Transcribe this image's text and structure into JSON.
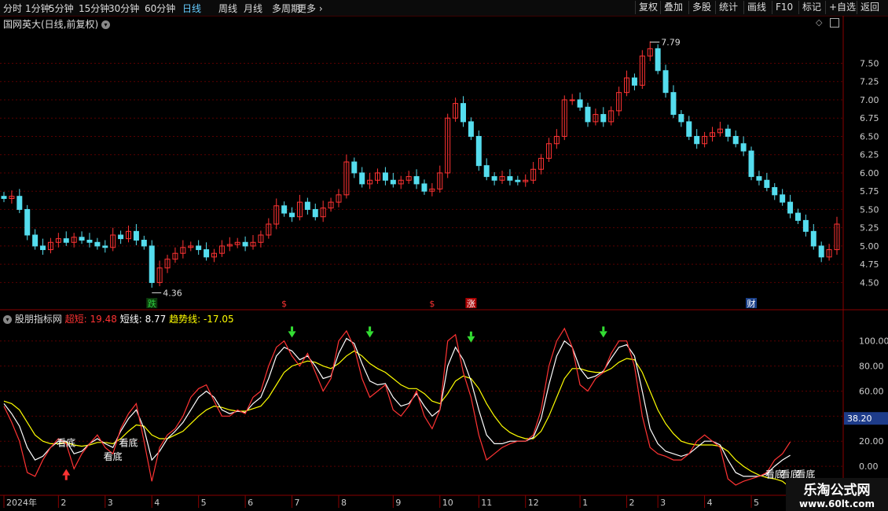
{
  "topbar": {
    "tabs": [
      "分时",
      "1分钟",
      "5分钟",
      "15分钟",
      "30分钟",
      "60分钟",
      "日线",
      "周线",
      "月线",
      "多周期",
      "更多"
    ],
    "active_tab": "日线",
    "right_buttons": [
      "复权",
      "叠加",
      "多股",
      "统计",
      "画线",
      "F10",
      "标记",
      "+自选",
      "返回"
    ]
  },
  "main_panel": {
    "title": "国网英大(日线,前复权)",
    "high_label": "7.79",
    "low_label": "4.36",
    "markers": [
      {
        "text": "跌",
        "color": "#2ecc40",
        "bg": "#0b3a0b",
        "idx": 19
      },
      {
        "text": "$",
        "color": "#ff3333",
        "bg": "",
        "idx": 36
      },
      {
        "text": "$",
        "color": "#ff3333",
        "bg": "",
        "idx": 55
      },
      {
        "text": "涨",
        "color": "#ffffff",
        "bg": "#aa0000",
        "idx": 60
      },
      {
        "text": "财",
        "color": "#ffffff",
        "bg": "#1a3f88",
        "idx": 96
      }
    ]
  },
  "indicator_panel": {
    "name": "股朋指标网",
    "items": [
      {
        "label": "超短: 19.48",
        "color": "#ff3333"
      },
      {
        "label": "短线: 8.77",
        "color": "#ffffff"
      },
      {
        "label": "趋势线: -17.05",
        "color": "#ffff00"
      }
    ],
    "current_value": "38.20",
    "annotations": [
      {
        "text": "看底",
        "idx": 8,
        "v": 16
      },
      {
        "text": "看底",
        "idx": 14,
        "v": 5
      },
      {
        "text": "看底",
        "idx": 16,
        "v": 16
      },
      {
        "text": "看底",
        "idx": 99,
        "v": -9
      },
      {
        "text": "看底",
        "idx": 101,
        "v": -9
      },
      {
        "text": "看底",
        "idx": 103,
        "v": -9
      },
      {
        "text": "看底",
        "idx": 106,
        "v": -20
      }
    ]
  },
  "time_axis": {
    "labels": [
      {
        "text": "2024年",
        "idx": 0
      },
      {
        "text": "2",
        "idx": 7
      },
      {
        "text": "3",
        "idx": 13
      },
      {
        "text": "4",
        "idx": 19
      },
      {
        "text": "5",
        "idx": 25
      },
      {
        "text": "6",
        "idx": 31
      },
      {
        "text": "7",
        "idx": 37
      },
      {
        "text": "8",
        "idx": 43
      },
      {
        "text": "9",
        "idx": 50
      },
      {
        "text": "10",
        "idx": 56
      },
      {
        "text": "11",
        "idx": 61
      },
      {
        "text": "12",
        "idx": 67
      },
      {
        "text": "1",
        "idx": 74
      },
      {
        "text": "2",
        "idx": 80
      },
      {
        "text": "3",
        "idx": 84
      },
      {
        "text": "4",
        "idx": 90
      },
      {
        "text": "5",
        "idx": 96
      }
    ]
  },
  "watermark": {
    "line1": "乐淘公式网",
    "line2": "www.60lt.com"
  },
  "chart_data": [
    {
      "type": "candlestick",
      "title": "国网英大(日线,前复权)",
      "ylim": [
        4.3,
        8.0
      ],
      "yticks": [
        4.5,
        4.75,
        5.0,
        5.25,
        5.5,
        5.75,
        6.0,
        6.25,
        6.5,
        6.75,
        7.0,
        7.25,
        7.5
      ],
      "high": 7.79,
      "low": 4.36,
      "close": [
        5.65,
        5.68,
        5.5,
        5.15,
        5.0,
        4.95,
        5.05,
        5.1,
        5.05,
        5.12,
        5.08,
        5.05,
        5.0,
        4.98,
        5.15,
        5.1,
        5.2,
        5.08,
        5.0,
        4.5,
        4.7,
        4.82,
        4.9,
        4.98,
        5.0,
        4.95,
        4.85,
        4.9,
        5.0,
        5.02,
        5.05,
        5.0,
        5.05,
        5.15,
        5.3,
        5.55,
        5.45,
        5.4,
        5.6,
        5.5,
        5.4,
        5.52,
        5.6,
        5.7,
        6.15,
        6.0,
        5.85,
        5.9,
        6.0,
        5.9,
        5.85,
        5.9,
        5.95,
        5.85,
        5.75,
        5.78,
        6.0,
        6.75,
        6.95,
        6.7,
        6.5,
        6.1,
        5.95,
        5.9,
        5.95,
        5.9,
        5.88,
        5.9,
        6.05,
        6.2,
        6.4,
        6.5,
        7.0,
        7.0,
        6.9,
        6.7,
        6.8,
        6.7,
        6.85,
        7.1,
        7.3,
        7.2,
        7.6,
        7.7,
        7.4,
        7.1,
        6.8,
        6.7,
        6.5,
        6.4,
        6.5,
        6.55,
        6.6,
        6.5,
        6.4,
        6.3,
        5.95,
        5.9,
        5.8,
        5.7,
        5.6,
        5.45,
        5.35,
        5.2,
        5.0,
        4.85,
        4.95,
        5.3
      ]
    },
    {
      "type": "line",
      "ylim": [
        -20,
        118
      ],
      "yticks": [
        0,
        20,
        40,
        60,
        80,
        100
      ],
      "series": [
        {
          "name": "超短",
          "color": "#ff3333",
          "values": [
            48,
            35,
            20,
            -5,
            -8,
            5,
            15,
            22,
            18,
            -2,
            10,
            18,
            25,
            15,
            10,
            30,
            42,
            50,
            20,
            -12,
            15,
            25,
            30,
            40,
            55,
            62,
            65,
            52,
            40,
            40,
            45,
            42,
            55,
            60,
            80,
            95,
            100,
            88,
            80,
            90,
            75,
            60,
            70,
            100,
            108,
            95,
            70,
            55,
            60,
            65,
            45,
            40,
            48,
            60,
            40,
            30,
            45,
            100,
            105,
            75,
            55,
            25,
            5,
            10,
            15,
            18,
            20,
            20,
            25,
            45,
            80,
            100,
            110,
            95,
            65,
            60,
            70,
            75,
            90,
            100,
            100,
            80,
            40,
            15,
            10,
            8,
            5,
            5,
            10,
            20,
            25,
            20,
            15,
            -10,
            -15,
            -12,
            -10,
            -8,
            -5,
            5,
            10,
            19.48
          ]
        },
        {
          "name": "短线",
          "color": "#ffffff",
          "values": [
            50,
            42,
            32,
            15,
            5,
            8,
            15,
            20,
            20,
            10,
            12,
            18,
            22,
            18,
            15,
            28,
            38,
            45,
            30,
            5,
            12,
            22,
            28,
            35,
            45,
            55,
            60,
            55,
            45,
            42,
            44,
            43,
            50,
            55,
            70,
            88,
            95,
            92,
            85,
            88,
            80,
            70,
            72,
            90,
            102,
            98,
            82,
            68,
            65,
            66,
            55,
            48,
            50,
            58,
            48,
            40,
            45,
            80,
            95,
            85,
            68,
            45,
            25,
            18,
            18,
            20,
            20,
            20,
            23,
            38,
            65,
            88,
            100,
            95,
            78,
            70,
            72,
            76,
            86,
            95,
            97,
            88,
            60,
            30,
            18,
            12,
            10,
            8,
            10,
            15,
            20,
            20,
            17,
            5,
            -5,
            -8,
            -8,
            -8,
            -6,
            0,
            5,
            8.77
          ]
        },
        {
          "name": "趋势线",
          "color": "#ffff00",
          "values": [
            52,
            50,
            45,
            35,
            25,
            20,
            18,
            18,
            19,
            17,
            16,
            17,
            19,
            19,
            18,
            22,
            28,
            33,
            32,
            25,
            22,
            22,
            25,
            28,
            34,
            40,
            45,
            48,
            47,
            45,
            44,
            44,
            46,
            48,
            55,
            65,
            75,
            80,
            82,
            84,
            83,
            80,
            78,
            82,
            88,
            92,
            88,
            82,
            78,
            75,
            70,
            65,
            62,
            62,
            58,
            52,
            50,
            58,
            68,
            72,
            70,
            62,
            50,
            40,
            32,
            27,
            24,
            22,
            22,
            28,
            40,
            55,
            70,
            78,
            78,
            76,
            75,
            75,
            78,
            83,
            86,
            85,
            75,
            60,
            45,
            34,
            26,
            20,
            18,
            17,
            17,
            17,
            16,
            12,
            5,
            0,
            -4,
            -7,
            -9,
            -10,
            -12,
            -17.05
          ]
        }
      ]
    }
  ]
}
